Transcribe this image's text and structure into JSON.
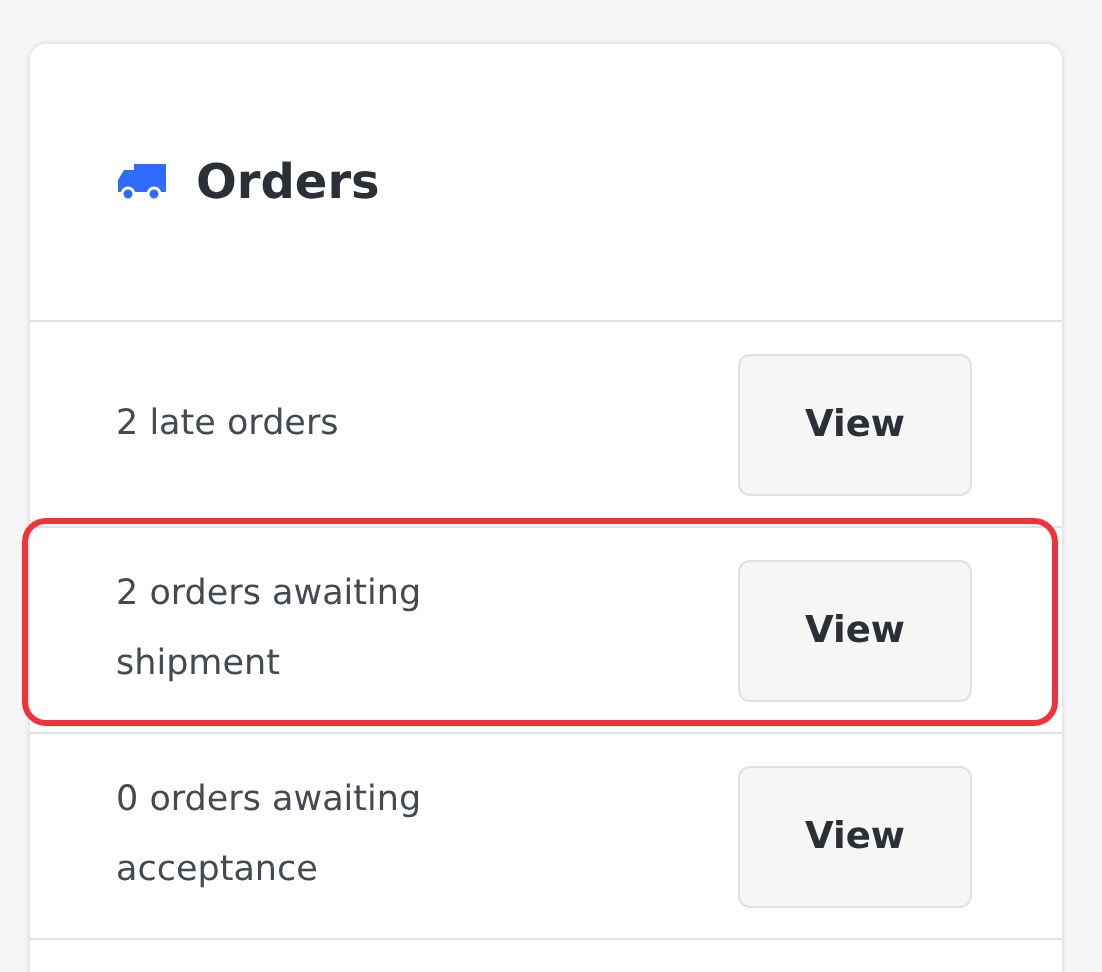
{
  "card": {
    "title": "Orders",
    "rows": [
      {
        "text": "2 late orders",
        "button": "View",
        "highlighted": false
      },
      {
        "text": "2 orders awaiting shipment",
        "button": "View",
        "highlighted": true
      },
      {
        "text": "0 orders awaiting acceptance",
        "button": "View",
        "highlighted": false
      }
    ]
  }
}
